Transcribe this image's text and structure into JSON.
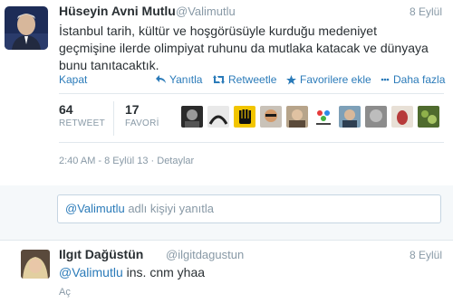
{
  "tweet": {
    "author_name": "Hüseyin Avni Mutlu",
    "author_handle": "@Valimutlu",
    "time": "8 Eylül",
    "text": "İstanbul tarih, kültür ve hoşgörüsüyle kurduğu medeniyet geçmişine ilerde olimpiyat ruhunu da mutlaka katacak ve dünyaya bunu tanıtacaktık.",
    "close_label": "Kapat",
    "actions": {
      "reply": "Yanıtla",
      "retweet": "Retweetle",
      "favorite": "Favorilere ekle",
      "more": "Daha fazla"
    },
    "stats": {
      "retweets": "64",
      "retweets_label": "RETWEET",
      "favorites": "17",
      "favorites_label": "FAVORİ"
    },
    "favoriters_icons": [
      "avatar-1",
      "avatar-2",
      "rabia-sign-avatar",
      "avatar-4",
      "avatar-5",
      "tsrsev-logo-avatar",
      "avatar-7",
      "avatar-8",
      "egg-avatar",
      "avatar-10"
    ],
    "detail_time": "2:40 AM - 8 Eylül 13",
    "detail_separator": "·",
    "details_link": "Detaylar"
  },
  "reply_box": {
    "mention": "@Valimutlu",
    "placeholder": "adlı kişiyi yanıtla"
  },
  "reply": {
    "author_name": "Ilgıt Dağüstün",
    "author_handle": "@ilgitdagustun",
    "time": "8 Eylül",
    "mention": "@Valimutlu",
    "text": "ins. cnm yhaa",
    "expand_label": "Aç"
  },
  "colors": {
    "link": "#2b7bb9",
    "muted": "#8899a6",
    "text": "#292f33",
    "reply_bg": "#f5f8fa"
  }
}
